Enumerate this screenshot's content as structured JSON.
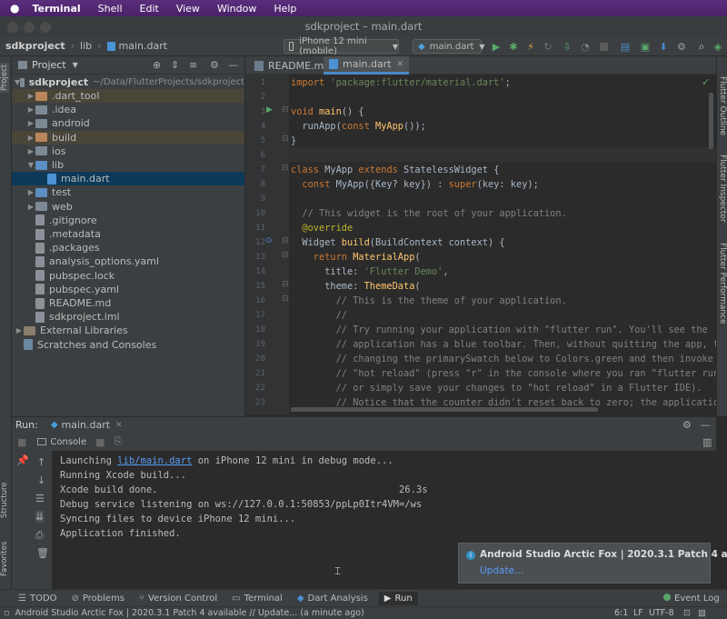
{
  "menubar": {
    "app": "Terminal",
    "items": [
      "Shell",
      "Edit",
      "View",
      "Window",
      "Help"
    ]
  },
  "window": {
    "title": "sdkproject – main.dart"
  },
  "navbar": {
    "breadcrumbs": [
      "sdkproject",
      "lib",
      "main.dart"
    ],
    "device": "iPhone 12 mini (mobile)",
    "run_config": "main.dart"
  },
  "project_panel": {
    "strip_label": "Project",
    "title": "Project",
    "root": {
      "name": "sdkproject",
      "path": "~/Data/FlutterProjects/sdkproject"
    },
    "items": [
      {
        "label": ".dart_tool",
        "kind": "folder-orange",
        "depth": 1,
        "arrow": "right"
      },
      {
        "label": ".idea",
        "kind": "folder",
        "depth": 1,
        "arrow": "right"
      },
      {
        "label": "android",
        "kind": "folder",
        "depth": 1,
        "arrow": "right"
      },
      {
        "label": "build",
        "kind": "folder-orange",
        "depth": 1,
        "arrow": "right"
      },
      {
        "label": "ios",
        "kind": "folder",
        "depth": 1,
        "arrow": "right"
      },
      {
        "label": "lib",
        "kind": "folder-blue",
        "depth": 1,
        "arrow": "down"
      },
      {
        "label": "main.dart",
        "kind": "dart",
        "depth": 2,
        "arrow": ""
      },
      {
        "label": "test",
        "kind": "folder-blue",
        "depth": 1,
        "arrow": "right"
      },
      {
        "label": "web",
        "kind": "folder",
        "depth": 1,
        "arrow": "right"
      },
      {
        "label": ".gitignore",
        "kind": "file",
        "depth": 1,
        "arrow": ""
      },
      {
        "label": ".metadata",
        "kind": "file",
        "depth": 1,
        "arrow": ""
      },
      {
        "label": ".packages",
        "kind": "file",
        "depth": 1,
        "arrow": ""
      },
      {
        "label": "analysis_options.yaml",
        "kind": "file",
        "depth": 1,
        "arrow": ""
      },
      {
        "label": "pubspec.lock",
        "kind": "file",
        "depth": 1,
        "arrow": ""
      },
      {
        "label": "pubspec.yaml",
        "kind": "file",
        "depth": 1,
        "arrow": ""
      },
      {
        "label": "README.md",
        "kind": "file",
        "depth": 1,
        "arrow": ""
      },
      {
        "label": "sdkproject.iml",
        "kind": "file",
        "depth": 1,
        "arrow": ""
      },
      {
        "label": "External Libraries",
        "kind": "lib",
        "depth": 0,
        "arrow": "right"
      },
      {
        "label": "Scratches and Consoles",
        "kind": "scratch",
        "depth": 0,
        "arrow": ""
      }
    ]
  },
  "editor": {
    "tabs": [
      "README.md",
      "main.dart"
    ],
    "active_tab": "main.dart",
    "lines": [
      {
        "n": "1",
        "parts": [
          [
            "kw",
            "import "
          ],
          [
            "str",
            "'package:flutter/material.dart'"
          ],
          [
            "cls",
            ";"
          ]
        ]
      },
      {
        "n": "2",
        "parts": []
      },
      {
        "n": "3",
        "parts": [
          [
            "kw",
            "void "
          ],
          [
            "fn",
            "main"
          ],
          [
            "cls",
            "() {"
          ]
        ]
      },
      {
        "n": "4",
        "parts": [
          [
            "cls",
            "  runApp("
          ],
          [
            "kw",
            "const "
          ],
          [
            "fn",
            "MyApp"
          ],
          [
            "cls",
            "());"
          ]
        ]
      },
      {
        "n": "5",
        "parts": [
          [
            "cls",
            "}"
          ]
        ]
      },
      {
        "n": "6",
        "parts": []
      },
      {
        "n": "7",
        "parts": [
          [
            "kw",
            "class "
          ],
          [
            "cls",
            "MyApp "
          ],
          [
            "kw",
            "extends "
          ],
          [
            "cls",
            "StatelessWidget {"
          ]
        ]
      },
      {
        "n": "8",
        "parts": [
          [
            "kw",
            "  const "
          ],
          [
            "cls",
            "MyApp({Key? key}) : "
          ],
          [
            "kw",
            "super"
          ],
          [
            "cls",
            "(key: key);"
          ]
        ]
      },
      {
        "n": "9",
        "parts": []
      },
      {
        "n": "10",
        "parts": [
          [
            "cm",
            "  // This widget is the root of your application."
          ]
        ]
      },
      {
        "n": "11",
        "parts": [
          [
            "an",
            "  @override"
          ]
        ]
      },
      {
        "n": "12",
        "parts": [
          [
            "cls",
            "  Widget "
          ],
          [
            "fn",
            "build"
          ],
          [
            "cls",
            "(BuildContext context) {"
          ]
        ]
      },
      {
        "n": "13",
        "parts": [
          [
            "kw",
            "    return "
          ],
          [
            "fn",
            "MaterialApp"
          ],
          [
            "cls",
            "("
          ]
        ]
      },
      {
        "n": "14",
        "parts": [
          [
            "cls",
            "      title: "
          ],
          [
            "str",
            "'Flutter Demo'"
          ],
          [
            "cls",
            ","
          ]
        ]
      },
      {
        "n": "15",
        "parts": [
          [
            "cls",
            "      theme: "
          ],
          [
            "fn",
            "ThemeData"
          ],
          [
            "cls",
            "("
          ]
        ]
      },
      {
        "n": "16",
        "parts": [
          [
            "cm",
            "        // This is the theme of your application."
          ]
        ]
      },
      {
        "n": "17",
        "parts": [
          [
            "cm",
            "        //"
          ]
        ]
      },
      {
        "n": "18",
        "parts": [
          [
            "cm",
            "        // Try running your application with \"flutter run\". You'll see the"
          ]
        ]
      },
      {
        "n": "19",
        "parts": [
          [
            "cm",
            "        // application has a blue toolbar. Then, without quitting the app, tr"
          ]
        ]
      },
      {
        "n": "20",
        "parts": [
          [
            "cm",
            "        // changing the primarySwatch below to Colors.green and then invoke"
          ]
        ]
      },
      {
        "n": "21",
        "parts": [
          [
            "cm",
            "        // \"hot reload\" (press \"r\" in the console where you ran \"flutter run\""
          ]
        ]
      },
      {
        "n": "22",
        "parts": [
          [
            "cm",
            "        // or simply save your changes to \"hot reload\" in a Flutter IDE)."
          ]
        ]
      },
      {
        "n": "23",
        "parts": [
          [
            "cm",
            "        // Notice that the counter didn't reset back to zero; the application"
          ]
        ]
      }
    ]
  },
  "right_tools": [
    "Flutter Outline",
    "Flutter Inspector",
    "Flutter Performance"
  ],
  "run_panel": {
    "label": "Run:",
    "config": "main.dart",
    "console_tab": "Console",
    "output": [
      {
        "pre": "Launching ",
        "link": "lib/main.dart",
        "post": " on iPhone 12 mini in debug mode..."
      },
      {
        "pre": "Running Xcode build...",
        "link": "",
        "post": ""
      },
      {
        "pre": "Xcode build done.                                          26.3s",
        "link": "",
        "post": ""
      },
      {
        "pre": "Debug service listening on ws://127.0.0.1:50853/ppLp0Itr4VM=/ws",
        "link": "",
        "post": ""
      },
      {
        "pre": "Syncing files to device iPhone 12 mini...",
        "link": "",
        "post": ""
      },
      {
        "pre": "Application finished.",
        "link": "",
        "post": ""
      }
    ]
  },
  "left_tools": [
    "Structure",
    "Favorites"
  ],
  "notification": {
    "title": "Android Studio Arctic Fox | 2020.3.1 Patch 4 a",
    "action": "Update..."
  },
  "bottom_tools": [
    "TODO",
    "Problems",
    "Version Control",
    "Terminal",
    "Dart Analysis",
    "Run"
  ],
  "event_log": "Event Log",
  "status": {
    "message": "Android Studio Arctic Fox | 2020.3.1 Patch 4 available // Update... (a minute ago)",
    "position": "6:1",
    "line_sep": "LF",
    "encoding": "UTF-8"
  },
  "colors": {
    "accent": "#4a88c7",
    "run_green": "#59a869",
    "selection": "#0d3a58"
  }
}
